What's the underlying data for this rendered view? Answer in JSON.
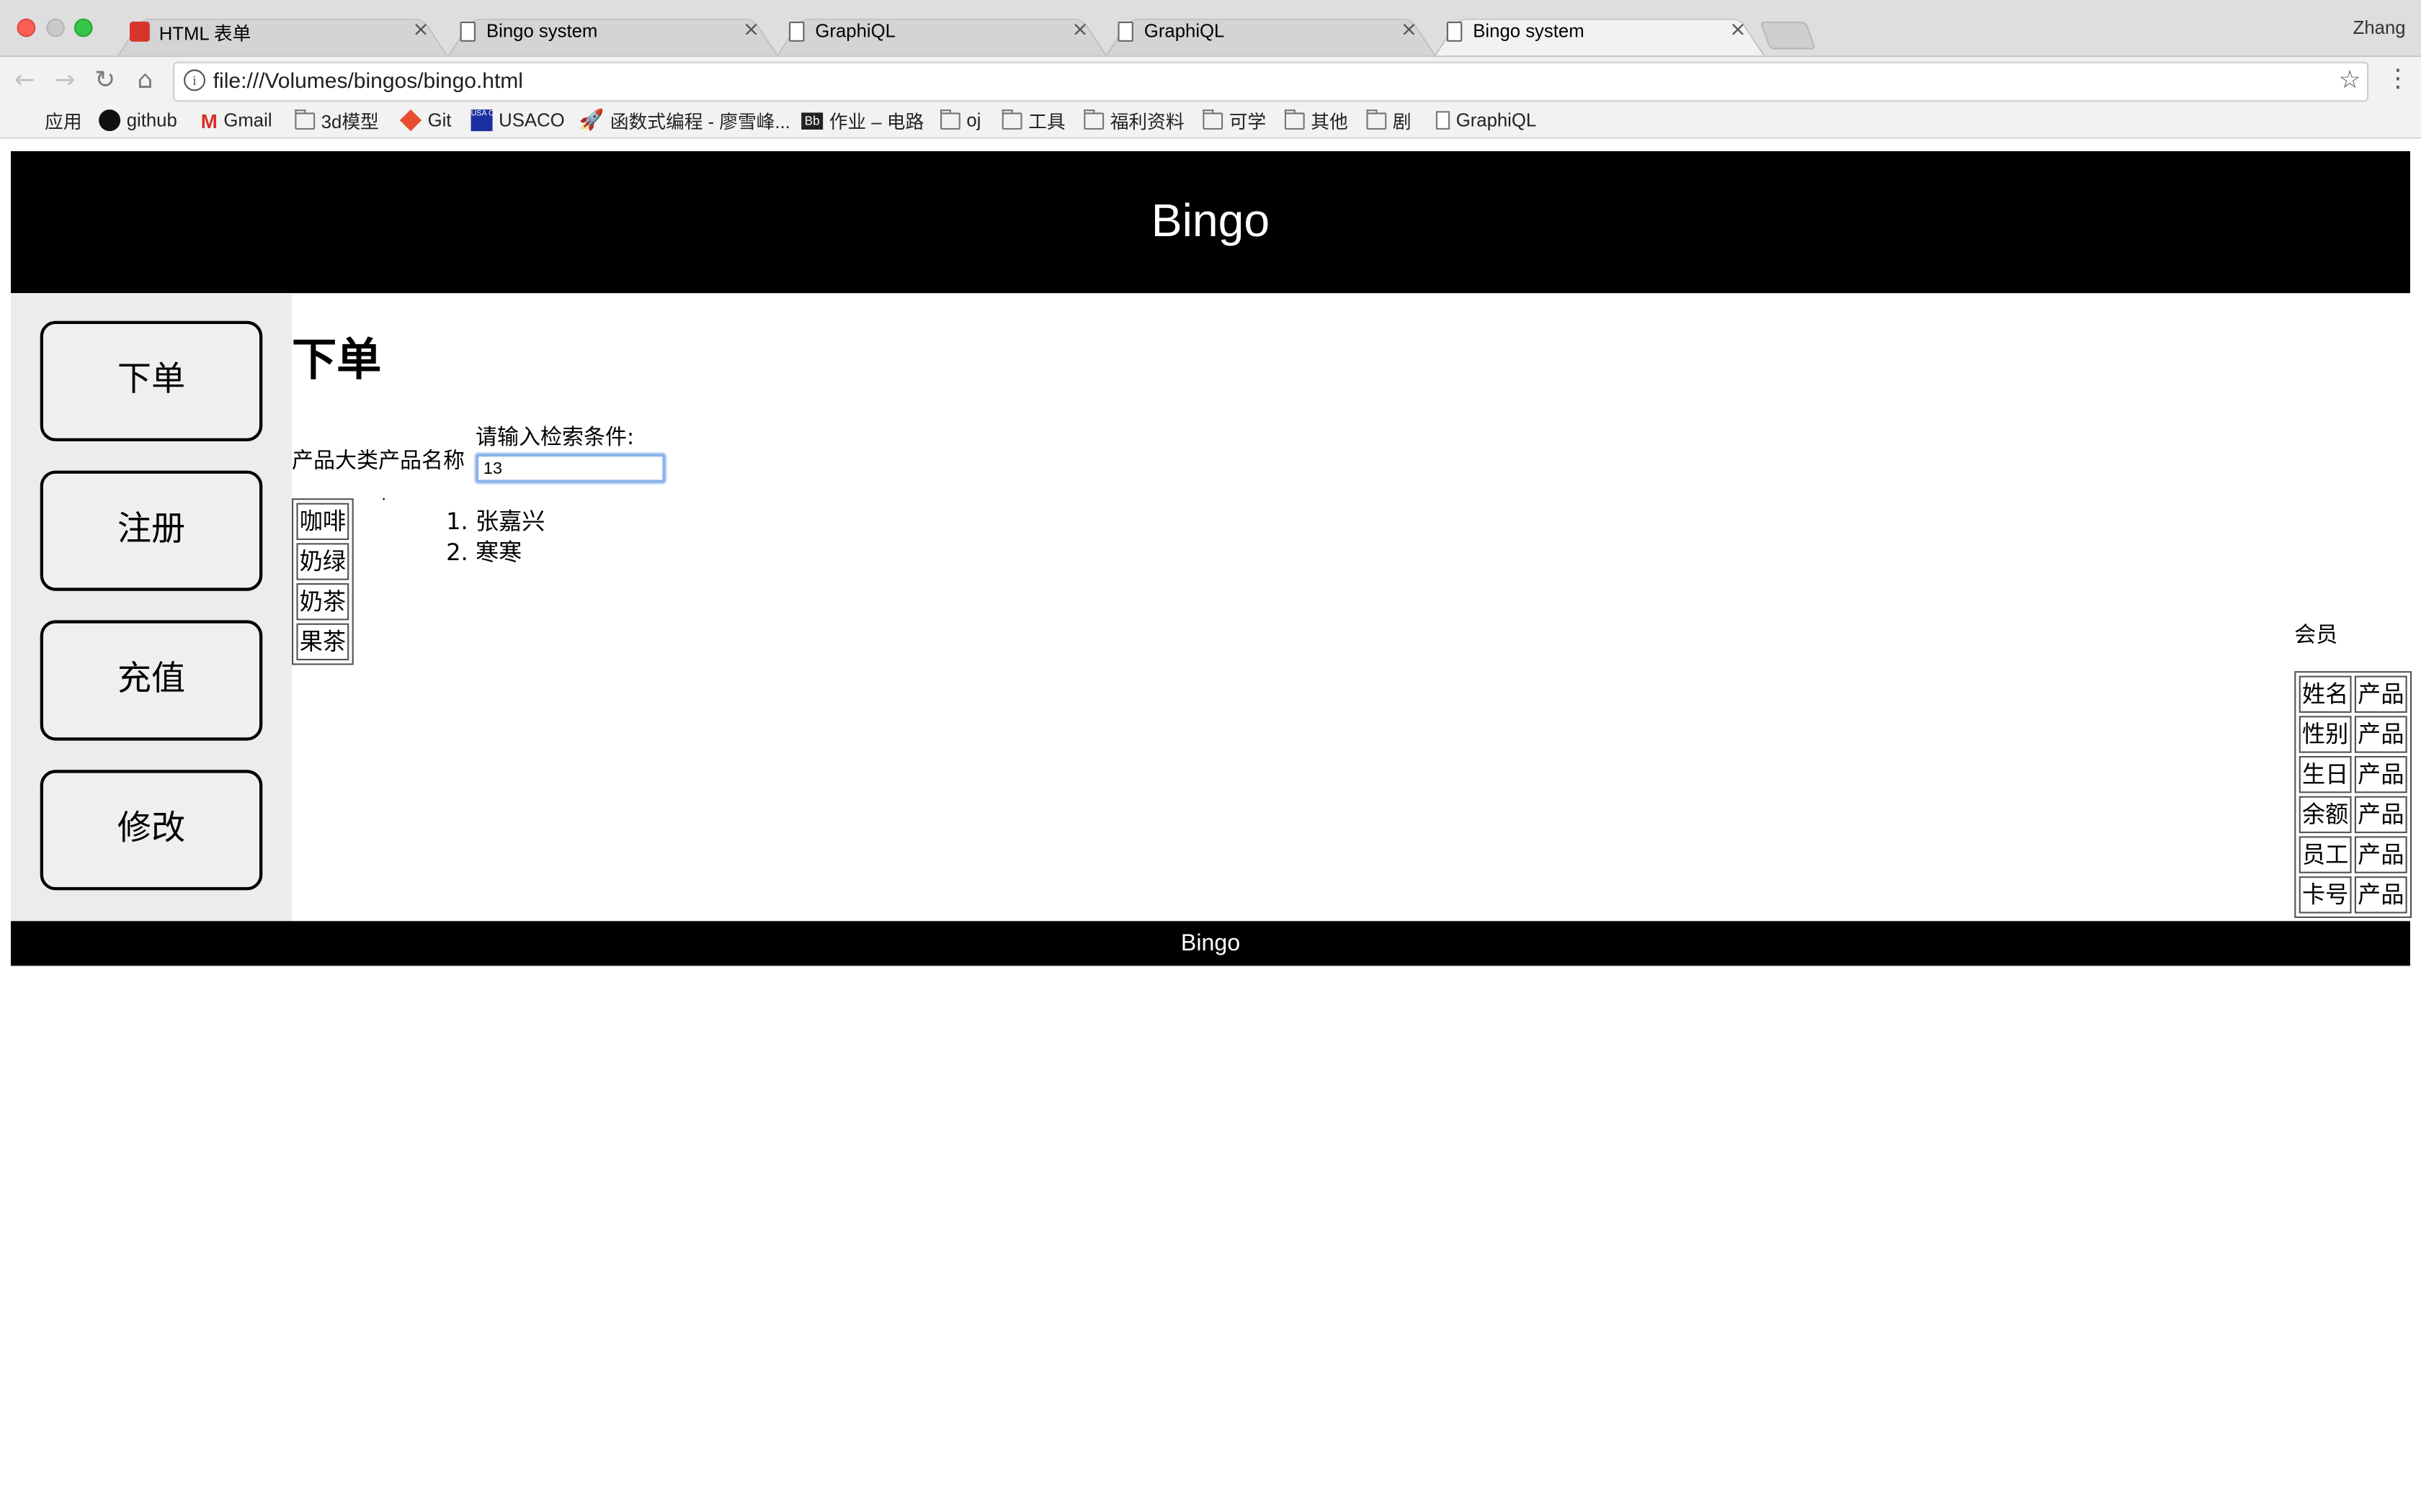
{
  "browser": {
    "tabs": [
      {
        "title": "HTML 表单",
        "active": false
      },
      {
        "title": "Bingo system",
        "active": false
      },
      {
        "title": "GraphiQL",
        "active": false
      },
      {
        "title": "GraphiQL",
        "active": false
      },
      {
        "title": "Bingo system",
        "active": true
      }
    ],
    "profile_name": "Zhang",
    "url": "file:///Volumes/bingos/bingo.html",
    "bookmarks": [
      {
        "label": "应用",
        "icon": "apps-grid-icon"
      },
      {
        "label": "github",
        "icon": "github-icon"
      },
      {
        "label": "Gmail",
        "icon": "gmail-icon"
      },
      {
        "label": "3d模型",
        "icon": "folder-icon"
      },
      {
        "label": "Git",
        "icon": "git-icon"
      },
      {
        "label": "USACO",
        "icon": "usaco-icon"
      },
      {
        "label": "函数式编程 - 廖雪峰...",
        "icon": "rocket-icon"
      },
      {
        "label": "作业 – 电路",
        "icon": "blackboard-icon"
      },
      {
        "label": "oj",
        "icon": "folder-icon"
      },
      {
        "label": "工具",
        "icon": "folder-icon"
      },
      {
        "label": "福利资料",
        "icon": "folder-icon"
      },
      {
        "label": "可学",
        "icon": "folder-icon"
      },
      {
        "label": "其他",
        "icon": "folder-icon"
      },
      {
        "label": "剧",
        "icon": "folder-icon"
      },
      {
        "label": "GraphiQL",
        "icon": "document-icon"
      }
    ]
  },
  "page": {
    "header_title": "Bingo",
    "footer_text": "Bingo",
    "sidebar_buttons": [
      "下单",
      "注册",
      "充值",
      "修改"
    ],
    "section_title": "下单",
    "filter_label": "产品大类产品名称",
    "search_label": "请输入检索条件:",
    "search_value": "13",
    "stray_mark": ".",
    "categories": [
      "咖啡",
      "奶绿",
      "奶茶",
      "果茶"
    ],
    "results": [
      "张嘉兴",
      "寒寒"
    ],
    "member": {
      "label": "会员",
      "rows": [
        [
          "姓名",
          "产品"
        ],
        [
          "性别",
          "产品"
        ],
        [
          "生日",
          "产品"
        ],
        [
          "余额",
          "产品"
        ],
        [
          "员工",
          "产品"
        ],
        [
          "卡号",
          "产品"
        ]
      ]
    }
  },
  "colors": {
    "header_bg": "#000000",
    "sidebar_bg": "#ececec",
    "input_focus": "#8cb4ee"
  }
}
